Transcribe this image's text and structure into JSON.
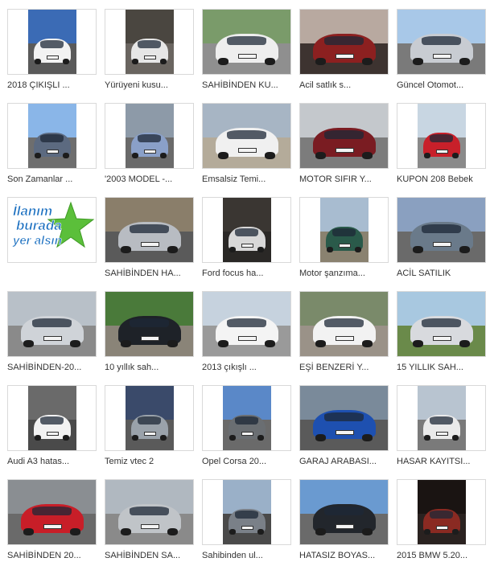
{
  "listings": [
    {
      "title": "2018 ÇIKIŞLI ...",
      "photo": "portrait",
      "sky": "#3b6bb5",
      "ground": "#5a5a5a",
      "car": "#f2f2f2"
    },
    {
      "title": "Yürüyeni kusu...",
      "photo": "portrait",
      "sky": "#4a4640",
      "ground": "#6a6560",
      "car": "#e6e6e6"
    },
    {
      "title": "SAHİBİNDEN KU...",
      "photo": "landscape",
      "sky": "#7a9b6a",
      "ground": "#8f8f8f",
      "car": "#eeeeee"
    },
    {
      "title": "Acil satlık s...",
      "photo": "landscape",
      "sky": "#b8a9a0",
      "ground": "#3d3330",
      "car": "#8c2020"
    },
    {
      "title": "Güncel Otomot...",
      "photo": "landscape",
      "sky": "#a8c8e8",
      "ground": "#7a7a7a",
      "car": "#c8ccd2"
    },
    {
      "title": "Son Zamanlar ...",
      "photo": "portrait",
      "sky": "#8ab6e8",
      "ground": "#6e6e6e",
      "car": "#5c6a80"
    },
    {
      "title": "'2003 MODEL -...",
      "photo": "portrait",
      "sky": "#8d9aa8",
      "ground": "#6a6a6a",
      "car": "#8aa0c8"
    },
    {
      "title": "Emsalsiz Temi...",
      "photo": "landscape",
      "sky": "#a7b5c4",
      "ground": "#b4ab9a",
      "car": "#f0f0f0"
    },
    {
      "title": "MOTOR SIFIR Y...",
      "photo": "landscape",
      "sky": "#c4c8cc",
      "ground": "#7c7c7c",
      "car": "#7a1c22"
    },
    {
      "title": "KUPON 208 Bebek",
      "photo": "portrait",
      "sky": "#c8d6e2",
      "ground": "#8a8a8a",
      "car": "#c8202a"
    },
    {
      "title": "",
      "photo": "promo",
      "sky": "#ffffff",
      "ground": "#ffffff",
      "car": "#ffffff"
    },
    {
      "title": "SAHİBİNDEN HA...",
      "photo": "landscape",
      "sky": "#8a7e6a",
      "ground": "#5a5a5a",
      "car": "#b8bcc2"
    },
    {
      "title": "Ford focus ha...",
      "photo": "portrait",
      "sky": "#3a3632",
      "ground": "#2a2826",
      "car": "#d8d8d8"
    },
    {
      "title": "Motor şanzıma...",
      "photo": "portrait",
      "sky": "#a8bcd0",
      "ground": "#8a8270",
      "car": "#2a5a4a"
    },
    {
      "title": "ACİL SATILIK",
      "photo": "landscape",
      "sky": "#8aa0c0",
      "ground": "#6a6a6a",
      "car": "#6a7a8a"
    },
    {
      "title": "SAHİBİNDEN-20...",
      "photo": "landscape",
      "sky": "#b8c0c8",
      "ground": "#8a8a8a",
      "car": "#cfd3d8"
    },
    {
      "title": "10 yıllık sah...",
      "photo": "landscape",
      "sky": "#4a7a3a",
      "ground": "#8a8478",
      "car": "#1e2228"
    },
    {
      "title": "2013 çıkışlı ...",
      "photo": "landscape",
      "sky": "#c6d2de",
      "ground": "#9a9a9a",
      "car": "#f4f4f4"
    },
    {
      "title": "EŞİ BENZERİ Y...",
      "photo": "landscape",
      "sky": "#7a8a6a",
      "ground": "#9a9288",
      "car": "#f2f2f2"
    },
    {
      "title": "15 YILLIK SAH...",
      "photo": "landscape",
      "sky": "#a8c8e0",
      "ground": "#6a8a4a",
      "car": "#d8dade"
    },
    {
      "title": "Audi A3 hatas...",
      "photo": "portrait",
      "sky": "#6a6a6a",
      "ground": "#4a4a4a",
      "car": "#f2f2f2"
    },
    {
      "title": "Temiz vtec 2",
      "photo": "portrait",
      "sky": "#3a4a6a",
      "ground": "#5a5a5a",
      "car": "#9aa2aa"
    },
    {
      "title": "Opel Corsa 20...",
      "photo": "portrait",
      "sky": "#5a88c8",
      "ground": "#6a6a6a",
      "car": "#6a6e72"
    },
    {
      "title": "GARAJ ARABASI...",
      "photo": "landscape",
      "sky": "#7a8a9a",
      "ground": "#5a5a5a",
      "car": "#1e50b0"
    },
    {
      "title": "HASAR KAYITSI...",
      "photo": "portrait",
      "sky": "#b8c4d0",
      "ground": "#7a7a7a",
      "car": "#eaeaea"
    },
    {
      "title": "SAHİBİNDEN 20...",
      "photo": "landscape",
      "sky": "#8a8e92",
      "ground": "#6a6a6a",
      "car": "#c81e28"
    },
    {
      "title": "SAHİBİNDEN SA...",
      "photo": "landscape",
      "sky": "#b0b8c0",
      "ground": "#8a8a8a",
      "car": "#c0c4c8"
    },
    {
      "title": "Sahibinden ul...",
      "photo": "portrait",
      "sky": "#9ab0c8",
      "ground": "#4a4a4a",
      "car": "#7a8088"
    },
    {
      "title": "HATASIZ BOYAS...",
      "photo": "landscape",
      "sky": "#6a9ad0",
      "ground": "#6a6a6a",
      "car": "#22262c"
    },
    {
      "title": "2015 BMW 5.20...",
      "photo": "portrait",
      "sky": "#1a1412",
      "ground": "#2a2220",
      "car": "#8a2a22"
    }
  ],
  "promo": {
    "line1": "İlanım",
    "line2": "burada",
    "line3": "yer alsın"
  }
}
